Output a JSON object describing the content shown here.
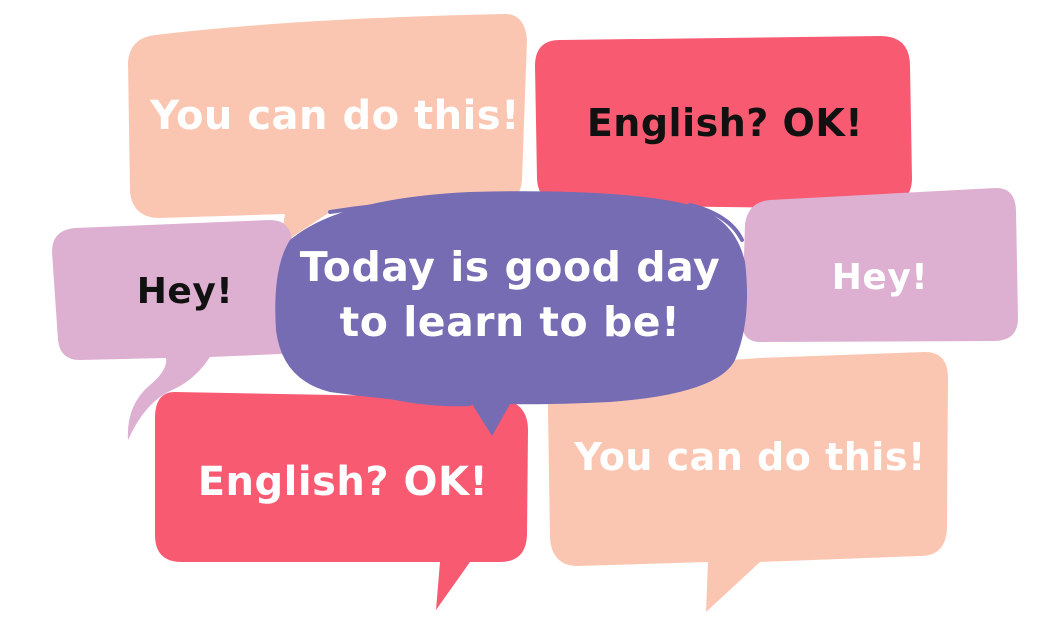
{
  "colors": {
    "background": "#ffffff",
    "peach": "#FBC6B1",
    "coral": "#F85A72",
    "lilac": "#DDB0D1",
    "purple": "#756CB3",
    "text_white": "#ffffff",
    "text_black": "#111111"
  },
  "bubbles": {
    "peach_top": {
      "text": "You can do this!"
    },
    "coral_top": {
      "text": "English? OK!"
    },
    "lilac_left": {
      "text": "Hey!"
    },
    "lilac_right": {
      "text": "Hey!"
    },
    "purple_center": {
      "line1": "Today is good day",
      "line2": "to learn to be!"
    },
    "coral_bottom": {
      "text": "English? OK!"
    },
    "peach_bottom": {
      "text": "You can do this!"
    }
  }
}
